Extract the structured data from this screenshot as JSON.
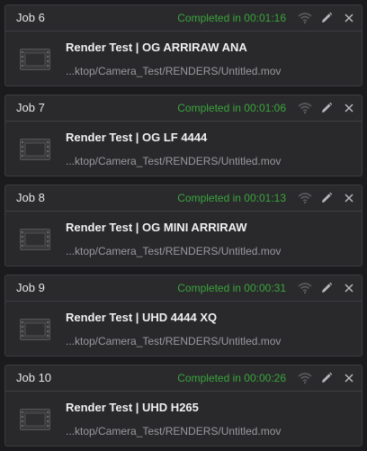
{
  "colors": {
    "background": "#1b1b1d",
    "card": "#29292c",
    "status_completed": "#3aa53a",
    "title_text": "#e6e6e6",
    "path_text": "#9a9a9e"
  },
  "jobs": [
    {
      "title": "Job 6",
      "status": "Completed in 00:01:16",
      "name": "Render Test | OG ARRIRAW ANA",
      "path": "...ktop/Camera_Test/RENDERS/Untitled.mov"
    },
    {
      "title": "Job 7",
      "status": "Completed in 00:01:06",
      "name": "Render Test | OG LF 4444",
      "path": "...ktop/Camera_Test/RENDERS/Untitled.mov"
    },
    {
      "title": "Job 8",
      "status": "Completed in 00:01:13",
      "name": "Render Test | OG MINI ARRIRAW",
      "path": "...ktop/Camera_Test/RENDERS/Untitled.mov"
    },
    {
      "title": "Job 9",
      "status": "Completed in 00:00:31",
      "name": "Render Test | UHD 4444 XQ",
      "path": "...ktop/Camera_Test/RENDERS/Untitled.mov"
    },
    {
      "title": "Job 10",
      "status": "Completed in 00:00:26",
      "name": "Render Test | UHD H265",
      "path": "...ktop/Camera_Test/RENDERS/Untitled.mov"
    }
  ],
  "icons": {
    "remote": "remote-render-icon",
    "edit": "pencil-icon",
    "close": "close-icon",
    "thumbnail": "film-clip-icon"
  }
}
